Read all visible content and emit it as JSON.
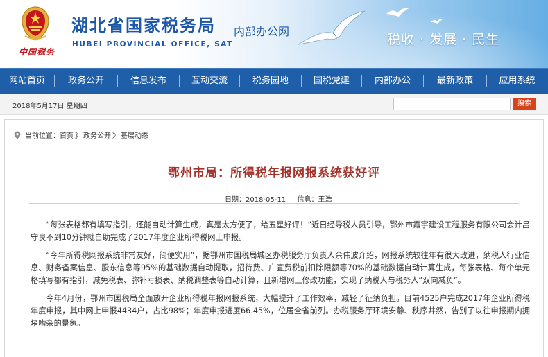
{
  "header": {
    "emblem_caption": "中国税务",
    "site_title": "湖北省国家税务局",
    "site_subtitle": "HUBEI PROVINCIAL OFFICE, SAT",
    "intranet_label": "内部办公网",
    "slogan": "税收 · 发展 · 民生",
    "colors": {
      "title_blue": "#1d57a6",
      "emblem_red": "#c4161c",
      "sky_blue": "#66aee3"
    }
  },
  "nav": {
    "background": "#1f5ea8",
    "items": [
      {
        "label": "网站首页"
      },
      {
        "label": "政务公开"
      },
      {
        "label": "信息发布"
      },
      {
        "label": "互动交流"
      },
      {
        "label": "税务园地"
      },
      {
        "label": "国税党建"
      },
      {
        "label": "内部办公"
      },
      {
        "label": "最新政策"
      },
      {
        "label": "应用系统"
      }
    ]
  },
  "infobar": {
    "date": "2018年5月17日  星期四",
    "search_value": "",
    "search_placeholder": "",
    "search_label": "搜索",
    "search_button_color": "#d8441a"
  },
  "breadcrumb": {
    "prefix": "当前位置：",
    "items": [
      "首页",
      "政务公开",
      "基层动态"
    ],
    "separator": "》",
    "icon": "location-icon"
  },
  "article": {
    "title": "鄂州市局：所得税年报网报系统获好评",
    "title_color": "#a3322a",
    "date_label": "日期：",
    "date": "2018-05-11",
    "author_label": "信息：",
    "author": "王浩",
    "paragraphs": [
      "“每张表格都有填写指引，还能自动计算生成，真是太方便了，给五星好评！”近日经导税人员引导，鄂州市霞宇建设工程服务有限公司会计吕守良不到10分钟就自助完成了2017年度企业所得税网上申报。",
      "“今年所得税网报系统非常友好，简便实用”，据鄂州市国税局城区办税服务厅负责人余伟波介绍，网报系统较往年有很大改进，纳税人行业信息、财务备案信息、股东信息等95%的基础数据自动提取，招待费、广宣费税前扣除限额等70%的基础数据自动计算生成，每张表格、每个单元格填写都有指引，减免税表、弥补亏损表、纳税调整表等自动计算，且新增网上修改功能，实现了纳税人与税务人“双向减负”。",
      "今年4月份，鄂州市国税局全面放开企业所得税年报网报系统，大幅提升了工作效率，减轻了征纳负担。目前4525户完成2017年企业所得税年度申报，其中网上申报4434户，占比98%；年度申报进度66.45%，位居全省前列。办税服务厅环境安静、秩序井然，告别了以往申报期内拥堵嘈杂的景象。"
    ]
  }
}
